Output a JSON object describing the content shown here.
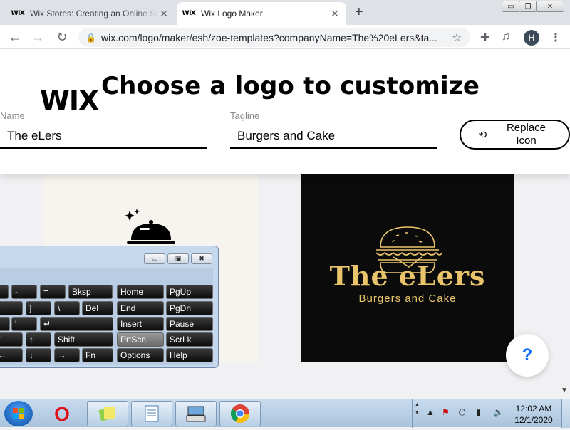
{
  "browser": {
    "tabs": [
      {
        "favicon": "WIX",
        "title": "Wix Stores: Creating an Online Store",
        "active": false
      },
      {
        "favicon": "WIX",
        "title": "Wix Logo Maker",
        "active": true
      }
    ],
    "new_tab": "+",
    "window_controls": {
      "minimize": "▭",
      "restore": "❐",
      "close": "✕"
    },
    "url": "wix.com/logo/maker/esh/zoe-templates?companyName=The%20eLers&ta...",
    "avatar_letter": "H"
  },
  "page": {
    "wix_logo": "WIX",
    "title": "Choose a logo to customize",
    "name_label": "Name",
    "name_value": "The eLers",
    "tagline_label": "Tagline",
    "tagline_value": "Burgers and Cake",
    "replace_icon_label": "Replace Icon",
    "templates": [
      {
        "background": "#f7f4ef",
        "icon": "cloche-icon"
      },
      {
        "background": "#0b0b0b",
        "icon": "burger-icon",
        "name": "The eLers",
        "tagline": "Burgers and Cake",
        "accent": "#e9c46a"
      }
    ],
    "help_label": "?"
  },
  "keyboard": {
    "rows": [
      [
        "-",
        "=",
        "Bksp",
        "Home",
        "PgUp"
      ],
      [
        "[",
        "]",
        "\\",
        "Del",
        "End",
        "PgDn"
      ],
      [
        ";",
        "'",
        "↵",
        "Insert",
        "Pause"
      ],
      [
        "/",
        "↑",
        "Shift",
        "PrtScn",
        "ScrLk"
      ],
      [
        "←",
        "↓",
        "→",
        "Fn",
        "Options",
        "Help"
      ]
    ]
  },
  "taskbar": {
    "time": "12:02 AM",
    "date": "12/1/2020"
  }
}
